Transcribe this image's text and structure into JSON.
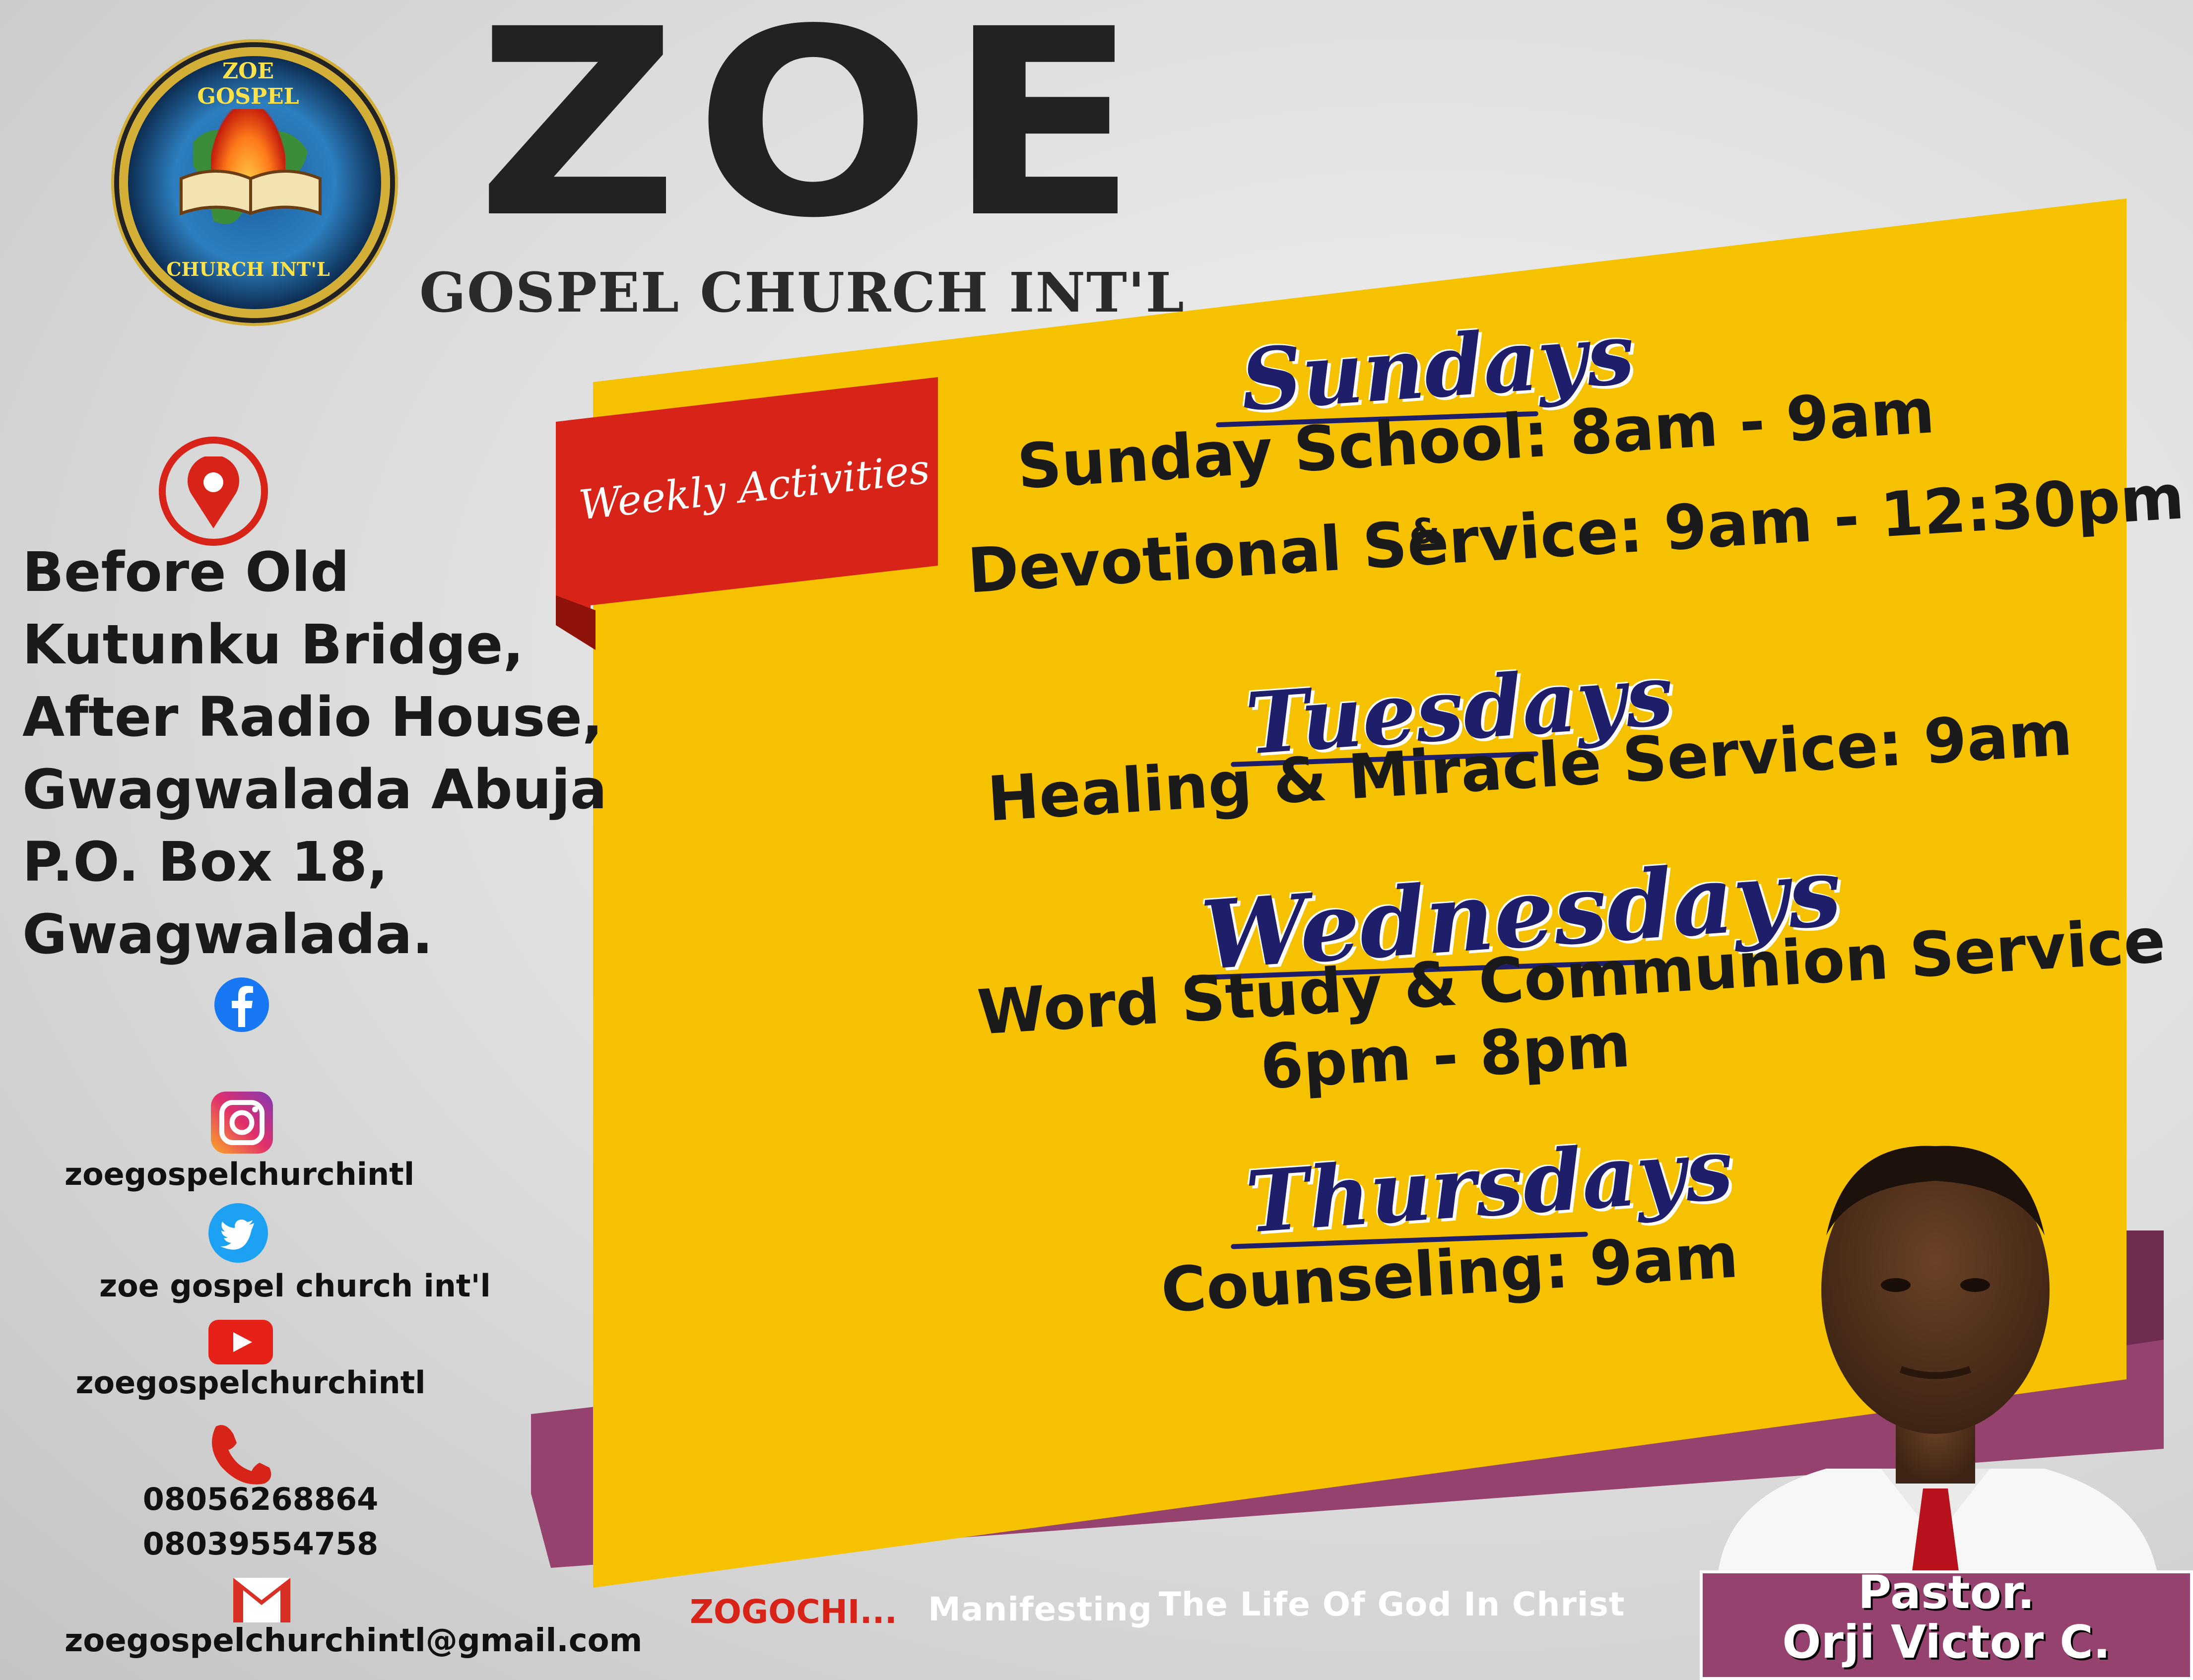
{
  "logo": {
    "ring_top": "ZOE GOSPEL",
    "ring_bottom": "CHURCH INT'L"
  },
  "header": {
    "title": "ZOE",
    "subtitle": "GOSPEL CHURCH INT'L"
  },
  "label": {
    "weekly": "Weekly Activities"
  },
  "schedule": {
    "sundays": {
      "heading": "Sundays",
      "line1": "Sunday School: 8am - 9am",
      "amp": "&",
      "line2": "Devotional Service: 9am - 12:30pm"
    },
    "tuesdays": {
      "heading": "Tuesdays",
      "line1": "Healing & Miracle Service: 9am"
    },
    "wednesdays": {
      "heading": "Wednesdays",
      "line1": "Word Study & Communion Service",
      "line2": "6pm - 8pm"
    },
    "thursdays": {
      "heading": "Thursdays",
      "line1": "Counseling: 9am"
    }
  },
  "address": {
    "lines": [
      "Before Old",
      "Kutunku Bridge,",
      "After Radio House,",
      "Gwagwalada Abuja",
      "P.O. Box 18,",
      "Gwagwalada."
    ]
  },
  "social": {
    "instagram": "zoegospelchurchintl",
    "twitter": "zoe gospel church int'l",
    "youtube": "zoegospelchurchintl",
    "phone1": "08056268864",
    "phone2": "08039554758",
    "email": "zoegospelchurchintl@gmail.com"
  },
  "footer": {
    "brand": "ZOGOCHI...",
    "tagline_part1": "Manifesting",
    "tagline_part2": "The Life Of God In Christ"
  },
  "pastor": {
    "title": "Pastor.",
    "name": "Orji Victor C."
  },
  "colors": {
    "yellow": "#f6c200",
    "purple": "#96426e",
    "red": "#d82418",
    "navy": "#1f1e6a"
  }
}
